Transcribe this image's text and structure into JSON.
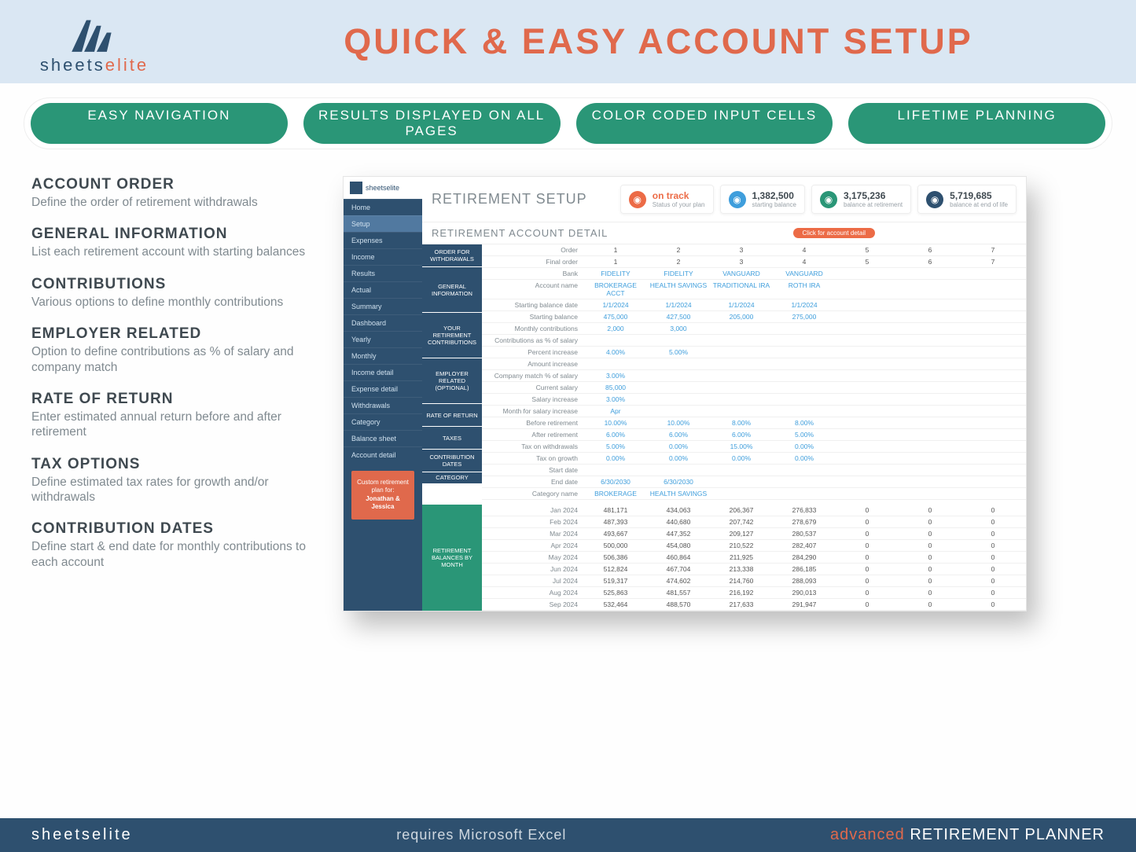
{
  "brand": {
    "name_a": "sheets",
    "name_b": "elite"
  },
  "page_title": "QUICK & EASY ACCOUNT SETUP",
  "pills": [
    "EASY NAVIGATION",
    "RESULTS DISPLAYED ON ALL PAGES",
    "COLOR CODED INPUT CELLS",
    "LIFETIME PLANNING"
  ],
  "features": [
    {
      "h": "ACCOUNT ORDER",
      "p": "Define the order of retirement withdrawals"
    },
    {
      "h": "GENERAL INFORMATION",
      "p": "List each retirement  account with starting balances"
    },
    {
      "h": "CONTRIBUTIONS",
      "p": "Various options to define monthly contributions"
    },
    {
      "h": "EMPLOYER RELATED",
      "p": "Option to define  contributions as % of salary and company match"
    },
    {
      "h": "RATE OF RETURN",
      "p": "Enter estimated annual return before and after retirement"
    },
    {
      "h": "TAX OPTIONS",
      "p": "Define estimated tax rates for growth and/or withdrawals"
    },
    {
      "h": "CONTRIBUTION DATES",
      "p": "Define start & end date for monthly contributions to each account"
    }
  ],
  "screenshot": {
    "logo": "sheetselite",
    "nav": [
      "Home",
      "Setup",
      "Expenses",
      "Income",
      "Results",
      "Actual",
      "Summary",
      "Dashboard",
      "Yearly",
      "Monthly",
      "Income detail",
      "Expense detail",
      "Withdrawals",
      "Category",
      "Balance sheet",
      "Account detail"
    ],
    "nav_active": "Setup",
    "callout": {
      "line1": "Custom retirement plan for:",
      "line2": "Jonathan & Jessica"
    },
    "title": "RETIREMENT SETUP",
    "stats": [
      {
        "icon": "orange",
        "value": "on track",
        "label": "Status of your plan"
      },
      {
        "icon": "blue",
        "value": "1,382,500",
        "label": "starting balance"
      },
      {
        "icon": "green",
        "value": "3,175,236",
        "label": "balance at retirement"
      },
      {
        "icon": "navy",
        "value": "5,719,685",
        "label": "balance at end of life"
      }
    ],
    "section": {
      "title": "RETIREMENT ACCOUNT DETAIL",
      "badge": "Click for account detail"
    },
    "groups": [
      {
        "label": "ORDER FOR WITHDRAWALS",
        "rows": 2
      },
      {
        "label": "GENERAL INFORMATION",
        "rows": 4
      },
      {
        "label": "YOUR RETIREMENT CONTRIBUTIONS",
        "rows": 4
      },
      {
        "label": "EMPLOYER RELATED (OPTIONAL)",
        "rows": 4
      },
      {
        "label": "RATE OF RETURN",
        "rows": 2
      },
      {
        "label": "TAXES",
        "rows": 2
      },
      {
        "label": "CONTRIBUTION DATES",
        "rows": 2
      },
      {
        "label": "CATEGORY",
        "rows": 1
      }
    ],
    "cols": [
      "1",
      "2",
      "3",
      "4",
      "5",
      "6",
      "7"
    ],
    "rows": [
      {
        "label": "Order",
        "v": [
          "1",
          "2",
          "3",
          "4",
          "5",
          "6",
          "7"
        ],
        "cls": "num"
      },
      {
        "label": "Final order",
        "v": [
          "1",
          "2",
          "3",
          "4",
          "5",
          "6",
          "7"
        ],
        "cls": "num"
      },
      {
        "label": "Bank",
        "v": [
          "FIDELITY",
          "FIDELITY",
          "VANGUARD",
          "VANGUARD",
          "",
          "",
          ""
        ],
        "cls": "link"
      },
      {
        "label": "Account name",
        "v": [
          "BROKERAGE ACCT",
          "HEALTH SAVINGS",
          "TRADITIONAL IRA",
          "ROTH IRA",
          "",
          "",
          ""
        ],
        "cls": "link"
      },
      {
        "label": "Starting balance date",
        "v": [
          "1/1/2024",
          "1/1/2024",
          "1/1/2024",
          "1/1/2024",
          "",
          "",
          ""
        ],
        "cls": "link"
      },
      {
        "label": "Starting balance",
        "v": [
          "475,000",
          "427,500",
          "205,000",
          "275,000",
          "",
          "",
          ""
        ],
        "cls": "link"
      },
      {
        "label": "Monthly contributions",
        "v": [
          "2,000",
          "3,000",
          "",
          "",
          "",
          "",
          ""
        ],
        "cls": "link"
      },
      {
        "label": "Contributions as % of salary",
        "v": [
          "",
          "",
          "",
          "",
          "",
          "",
          ""
        ],
        "cls": "link"
      },
      {
        "label": "Percent increase",
        "v": [
          "4.00%",
          "5.00%",
          "",
          "",
          "",
          "",
          ""
        ],
        "cls": "link"
      },
      {
        "label": "Amount increase",
        "v": [
          "",
          "",
          "",
          "",
          "",
          "",
          ""
        ],
        "cls": "link"
      },
      {
        "label": "Company match % of salary",
        "v": [
          "3.00%",
          "",
          "",
          "",
          "",
          "",
          ""
        ],
        "cls": "link"
      },
      {
        "label": "Current salary",
        "v": [
          "85,000",
          "",
          "",
          "",
          "",
          "",
          ""
        ],
        "cls": "link"
      },
      {
        "label": "Salary increase",
        "v": [
          "3.00%",
          "",
          "",
          "",
          "",
          "",
          ""
        ],
        "cls": "link"
      },
      {
        "label": "Month for salary increase",
        "v": [
          "Apr",
          "",
          "",
          "",
          "",
          "",
          ""
        ],
        "cls": "link"
      },
      {
        "label": "Before retirement",
        "v": [
          "10.00%",
          "10.00%",
          "8.00%",
          "8.00%",
          "",
          "",
          ""
        ],
        "cls": "link"
      },
      {
        "label": "After retirement",
        "v": [
          "6.00%",
          "6.00%",
          "6.00%",
          "5.00%",
          "",
          "",
          ""
        ],
        "cls": "link"
      },
      {
        "label": "Tax on withdrawals",
        "v": [
          "5.00%",
          "0.00%",
          "15.00%",
          "0.00%",
          "",
          "",
          ""
        ],
        "cls": "link"
      },
      {
        "label": "Tax on growth",
        "v": [
          "0.00%",
          "0.00%",
          "0.00%",
          "0.00%",
          "",
          "",
          ""
        ],
        "cls": "link"
      },
      {
        "label": "Start date",
        "v": [
          "",
          "",
          "",
          "",
          "",
          "",
          ""
        ],
        "cls": "link"
      },
      {
        "label": "End date",
        "v": [
          "6/30/2030",
          "6/30/2030",
          "",
          "",
          "",
          "",
          ""
        ],
        "cls": "link"
      },
      {
        "label": "Category name",
        "v": [
          "BROKERAGE",
          "HEALTH SAVINGS",
          "",
          "",
          "",
          "",
          ""
        ],
        "cls": "link"
      }
    ],
    "balances_label": "RETIREMENT BALANCES BY MONTH",
    "balances": [
      {
        "m": "Jan 2024",
        "v": [
          "481,171",
          "434,063",
          "206,367",
          "276,833",
          "0",
          "0",
          "0"
        ]
      },
      {
        "m": "Feb 2024",
        "v": [
          "487,393",
          "440,680",
          "207,742",
          "278,679",
          "0",
          "0",
          "0"
        ]
      },
      {
        "m": "Mar 2024",
        "v": [
          "493,667",
          "447,352",
          "209,127",
          "280,537",
          "0",
          "0",
          "0"
        ]
      },
      {
        "m": "Apr 2024",
        "v": [
          "500,000",
          "454,080",
          "210,522",
          "282,407",
          "0",
          "0",
          "0"
        ]
      },
      {
        "m": "May 2024",
        "v": [
          "506,386",
          "460,864",
          "211,925",
          "284,290",
          "0",
          "0",
          "0"
        ]
      },
      {
        "m": "Jun 2024",
        "v": [
          "512,824",
          "467,704",
          "213,338",
          "286,185",
          "0",
          "0",
          "0"
        ]
      },
      {
        "m": "Jul 2024",
        "v": [
          "519,317",
          "474,602",
          "214,760",
          "288,093",
          "0",
          "0",
          "0"
        ]
      },
      {
        "m": "Aug 2024",
        "v": [
          "525,863",
          "481,557",
          "216,192",
          "290,013",
          "0",
          "0",
          "0"
        ]
      },
      {
        "m": "Sep 2024",
        "v": [
          "532,464",
          "488,570",
          "217,633",
          "291,947",
          "0",
          "0",
          "0"
        ]
      }
    ]
  },
  "footer": {
    "logo_a": "sheets",
    "logo_b": "elite",
    "mid": "requires Microsoft Excel",
    "right_a": "advanced",
    "right_b": " RETIREMENT PLANNER"
  }
}
